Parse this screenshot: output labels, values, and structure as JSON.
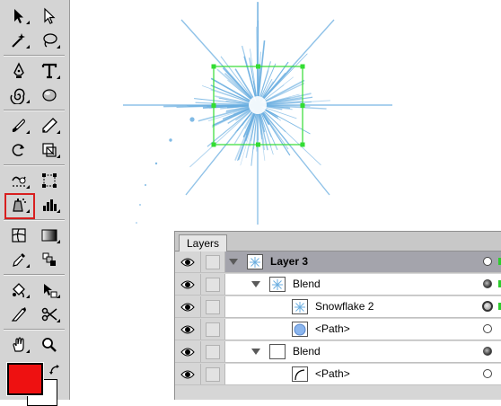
{
  "toolbar": {
    "fill_color": "#ee1111",
    "stroke_color": "#ffffff",
    "selected_tool_outline": "#d81f1f",
    "tools": [
      {
        "icon": "selection-arrow-icon"
      },
      {
        "icon": "direct-selection-icon"
      },
      {
        "icon": "magic-wand-icon"
      },
      {
        "icon": "lasso-icon"
      },
      {
        "icon": "pen-tool-icon"
      },
      {
        "icon": "type-tool-icon"
      },
      {
        "icon": "spiral-tool-icon"
      },
      {
        "icon": "ellipse-tool-icon"
      },
      {
        "icon": "paintbrush-tool-icon"
      },
      {
        "icon": "pencil-tool-icon"
      },
      {
        "icon": "rotate-tool-icon"
      },
      {
        "icon": "scale-tool-icon"
      },
      {
        "icon": "warp-tool-icon"
      },
      {
        "icon": "free-transform-icon"
      },
      {
        "icon": "symbol-sprayer-icon"
      },
      {
        "icon": "column-graph-icon"
      },
      {
        "icon": "mesh-tool-icon"
      },
      {
        "icon": "gradient-tool-icon"
      },
      {
        "icon": "eyedropper-tool-icon"
      },
      {
        "icon": "blend-tool-icon"
      },
      {
        "icon": "live-paint-bucket-icon"
      },
      {
        "icon": "live-paint-selection-icon"
      },
      {
        "icon": "slice-tool-icon"
      },
      {
        "icon": "scissors-tool-icon"
      },
      {
        "icon": "hand-tool-icon"
      },
      {
        "icon": "zoom-tool-icon"
      }
    ]
  },
  "canvas": {
    "artwork_color": "#6aaee0",
    "selection_color": "#33dd33"
  },
  "layers_panel": {
    "tab_label": "Layers",
    "rows": [
      {
        "label": "Layer 3",
        "bold": true,
        "indent": 0,
        "expanded": true,
        "thumb": "snowflake",
        "target": "empty",
        "highlight": true,
        "selected": true
      },
      {
        "label": "Blend",
        "bold": false,
        "indent": 1,
        "expanded": true,
        "thumb": "snowflake",
        "target": "filled",
        "highlight": false,
        "selected": true
      },
      {
        "label": "Snowflake 2",
        "bold": false,
        "indent": 2,
        "expanded": null,
        "thumb": "snowflake",
        "target": "double",
        "highlight": false,
        "selected": true
      },
      {
        "label": "<Path>",
        "bold": false,
        "indent": 2,
        "expanded": null,
        "thumb": "blue-dot",
        "target": "empty",
        "highlight": false,
        "selected": false
      },
      {
        "label": "Blend",
        "bold": false,
        "indent": 1,
        "expanded": true,
        "thumb": "blank",
        "target": "filled",
        "highlight": false,
        "selected": false
      },
      {
        "label": "<Path>",
        "bold": false,
        "indent": 2,
        "expanded": null,
        "thumb": "curve",
        "target": "empty",
        "highlight": false,
        "selected": false
      }
    ]
  }
}
